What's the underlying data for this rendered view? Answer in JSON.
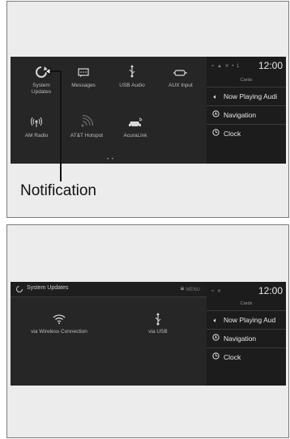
{
  "panel1": {
    "status": "≈ ▲ ✕ • 1",
    "clock": "12:00",
    "cards_label": "Cards",
    "apps": [
      {
        "label": "System\nUpdates",
        "icon": "system-updates-icon"
      },
      {
        "label": "Messages",
        "icon": "messages-icon"
      },
      {
        "label": "USB Audio",
        "icon": "usb-icon"
      },
      {
        "label": "AUX Input",
        "icon": "aux-input-icon"
      },
      {
        "label": "AM Radio",
        "icon": "am-radio-icon"
      },
      {
        "label": "AT&T Hotspot",
        "icon": "hotspot-icon"
      },
      {
        "label": "AcuraLink",
        "icon": "acuralink-icon"
      }
    ],
    "cards": [
      {
        "label": "Now Playing Audi",
        "icon": "speaker-icon"
      },
      {
        "label": "Navigation",
        "icon": "navigation-icon"
      },
      {
        "label": "Clock",
        "icon": "clock-icon"
      }
    ],
    "page_dots": "• •",
    "callout": "Notification"
  },
  "panel2": {
    "title": "System Updates",
    "menu_label": "MENU",
    "status": "≈ ✕",
    "clock": "12:00",
    "cards_label": "Cards",
    "options": [
      {
        "label": "via Wireless Connection",
        "icon": "wifi-icon"
      },
      {
        "label": "via USB",
        "icon": "usb-icon"
      }
    ],
    "cards": [
      {
        "label": "Now Playing Aud",
        "icon": "speaker-icon"
      },
      {
        "label": "Navigation",
        "icon": "navigation-icon"
      },
      {
        "label": "Clock",
        "icon": "clock-icon"
      }
    ]
  }
}
